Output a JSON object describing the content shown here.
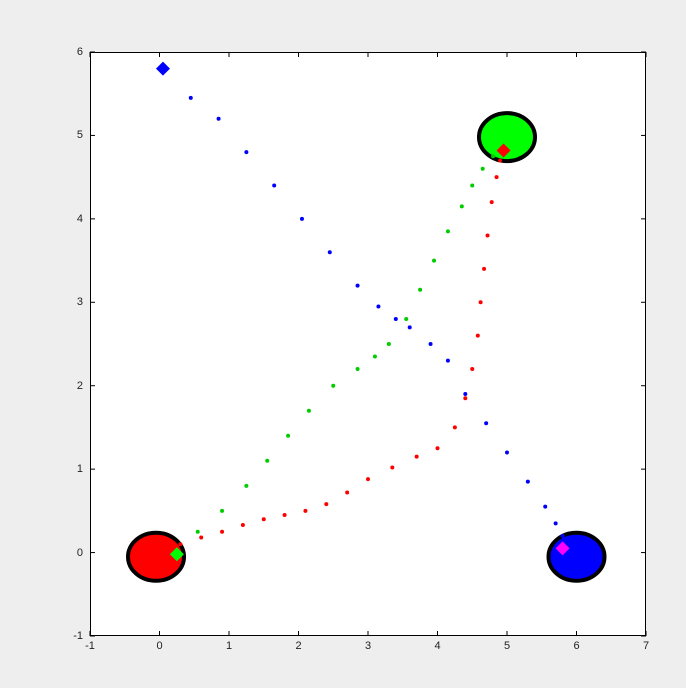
{
  "chart_data": {
    "type": "scatter",
    "xlabel": "",
    "ylabel": "",
    "title": "",
    "xlim": [
      -1,
      7
    ],
    "ylim": [
      -1,
      6
    ],
    "xticks": [
      -1,
      0,
      1,
      2,
      3,
      4,
      5,
      6,
      7
    ],
    "yticks": [
      -1,
      0,
      1,
      2,
      3,
      4,
      5,
      6
    ],
    "big_circles": [
      {
        "x": -0.05,
        "y": -0.05,
        "fill": "#ff0000",
        "stroke": "#000000"
      },
      {
        "x": 5.0,
        "y": 4.98,
        "fill": "#00ff00",
        "stroke": "#000000"
      },
      {
        "x": 6.0,
        "y": -0.05,
        "fill": "#0000ff",
        "stroke": "#000000"
      }
    ],
    "diamonds": [
      {
        "x": 0.05,
        "y": 5.8,
        "fill": "#0000ff"
      },
      {
        "x": 4.95,
        "y": 4.82,
        "fill": "#ff0000"
      },
      {
        "x": 0.25,
        "y": -0.02,
        "fill": "#00ff00"
      },
      {
        "x": 5.8,
        "y": 0.05,
        "fill": "#ff00ff"
      }
    ],
    "series": [
      {
        "name": "blue-trail",
        "color": "#0000ff",
        "points": [
          {
            "x": 0.05,
            "y": 5.8
          },
          {
            "x": 0.45,
            "y": 5.45
          },
          {
            "x": 0.85,
            "y": 5.2
          },
          {
            "x": 1.25,
            "y": 4.8
          },
          {
            "x": 1.65,
            "y": 4.4
          },
          {
            "x": 2.05,
            "y": 4.0
          },
          {
            "x": 2.45,
            "y": 3.6
          },
          {
            "x": 2.85,
            "y": 3.2
          },
          {
            "x": 3.15,
            "y": 2.95
          },
          {
            "x": 3.4,
            "y": 2.8
          },
          {
            "x": 3.6,
            "y": 2.7
          },
          {
            "x": 3.9,
            "y": 2.5
          },
          {
            "x": 4.15,
            "y": 2.3
          },
          {
            "x": 4.4,
            "y": 1.9
          },
          {
            "x": 4.7,
            "y": 1.55
          },
          {
            "x": 5.0,
            "y": 1.2
          },
          {
            "x": 5.3,
            "y": 0.85
          },
          {
            "x": 5.55,
            "y": 0.55
          },
          {
            "x": 5.7,
            "y": 0.35
          },
          {
            "x": 5.8,
            "y": 0.2
          },
          {
            "x": 5.85,
            "y": 0.1
          }
        ]
      },
      {
        "name": "green-trail",
        "color": "#00cc00",
        "points": [
          {
            "x": 0.25,
            "y": -0.02
          },
          {
            "x": 0.55,
            "y": 0.25
          },
          {
            "x": 0.9,
            "y": 0.5
          },
          {
            "x": 1.25,
            "y": 0.8
          },
          {
            "x": 1.55,
            "y": 1.1
          },
          {
            "x": 1.85,
            "y": 1.4
          },
          {
            "x": 2.15,
            "y": 1.7
          },
          {
            "x": 2.5,
            "y": 2.0
          },
          {
            "x": 2.85,
            "y": 2.2
          },
          {
            "x": 3.1,
            "y": 2.35
          },
          {
            "x": 3.3,
            "y": 2.5
          },
          {
            "x": 3.55,
            "y": 2.8
          },
          {
            "x": 3.75,
            "y": 3.15
          },
          {
            "x": 3.95,
            "y": 3.5
          },
          {
            "x": 4.15,
            "y": 3.85
          },
          {
            "x": 4.35,
            "y": 4.15
          },
          {
            "x": 4.5,
            "y": 4.4
          },
          {
            "x": 4.65,
            "y": 4.6
          },
          {
            "x": 4.8,
            "y": 4.75
          }
        ]
      },
      {
        "name": "red-trail",
        "color": "#ff0000",
        "points": [
          {
            "x": 0.3,
            "y": 0.1
          },
          {
            "x": 0.6,
            "y": 0.18
          },
          {
            "x": 0.9,
            "y": 0.25
          },
          {
            "x": 1.2,
            "y": 0.33
          },
          {
            "x": 1.5,
            "y": 0.4
          },
          {
            "x": 1.8,
            "y": 0.45
          },
          {
            "x": 2.1,
            "y": 0.5
          },
          {
            "x": 2.4,
            "y": 0.58
          },
          {
            "x": 2.7,
            "y": 0.72
          },
          {
            "x": 3.0,
            "y": 0.88
          },
          {
            "x": 3.35,
            "y": 1.02
          },
          {
            "x": 3.7,
            "y": 1.15
          },
          {
            "x": 4.0,
            "y": 1.25
          },
          {
            "x": 4.25,
            "y": 1.5
          },
          {
            "x": 4.4,
            "y": 1.85
          },
          {
            "x": 4.5,
            "y": 2.2
          },
          {
            "x": 4.58,
            "y": 2.6
          },
          {
            "x": 4.62,
            "y": 3.0
          },
          {
            "x": 4.67,
            "y": 3.4
          },
          {
            "x": 4.72,
            "y": 3.8
          },
          {
            "x": 4.78,
            "y": 4.2
          },
          {
            "x": 4.85,
            "y": 4.5
          },
          {
            "x": 4.9,
            "y": 4.7
          }
        ]
      }
    ]
  }
}
